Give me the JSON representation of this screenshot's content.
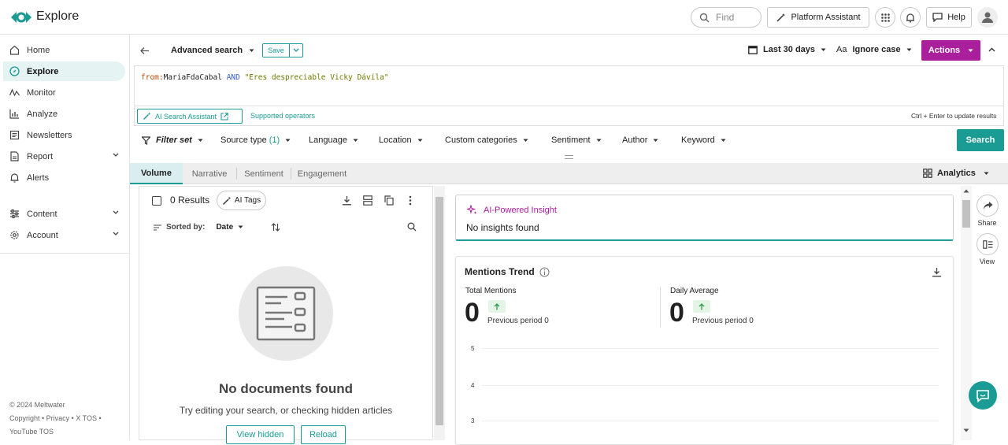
{
  "app": {
    "title": "Explore"
  },
  "topbar": {
    "find_placeholder": "Find",
    "platform_assistant_label": "Platform Assistant",
    "help_label": "Help"
  },
  "sidebar": {
    "items": [
      {
        "label": "Home",
        "icon": "home-icon"
      },
      {
        "label": "Explore",
        "icon": "compass-icon",
        "active": true
      },
      {
        "label": "Monitor",
        "icon": "pulse-icon"
      },
      {
        "label": "Analyze",
        "icon": "bar-chart-icon"
      },
      {
        "label": "Newsletters",
        "icon": "newsletter-icon"
      },
      {
        "label": "Report",
        "icon": "report-icon",
        "expandable": true
      },
      {
        "label": "Alerts",
        "icon": "bell-icon"
      },
      {
        "label": "Content",
        "icon": "sliders-icon",
        "expandable": true
      },
      {
        "label": "Account",
        "icon": "gear-icon",
        "expandable": true
      }
    ],
    "footer": {
      "copyright": "© 2024 Meltwater",
      "links_line1": "Copyright • Privacy • X TOS •",
      "links_line2": "YouTube TOS"
    }
  },
  "search": {
    "mode_label": "Advanced search",
    "save_label": "Save",
    "date_range": "Last 30 days",
    "case_label": "Ignore case",
    "actions_label": "Actions",
    "query": {
      "op1": "from:",
      "val1": "MariaFdaCabal",
      "kw": " AND ",
      "str": "\"Eres despreciable Vicky Dávila\""
    },
    "ai_assistant_label": "AI Search Assistant",
    "supported_operators_label": "Supported operators",
    "hint": "Ctrl + Enter to update results",
    "filters": {
      "filter_set": "Filter set",
      "source_type": "Source type",
      "source_type_count": "(1)",
      "language": "Language",
      "location": "Location",
      "custom_categories": "Custom categories",
      "sentiment": "Sentiment",
      "author": "Author",
      "keyword": "Keyword"
    },
    "search_button": "Search"
  },
  "tabs": [
    {
      "label": "Volume",
      "active": true
    },
    {
      "label": "Narrative"
    },
    {
      "label": "Sentiment"
    },
    {
      "label": "Engagement"
    }
  ],
  "analytics_label": "Analytics",
  "results": {
    "count_label": "0 Results",
    "ai_tags_label": "AI Tags",
    "sorted_by_label": "Sorted by:",
    "sort_value": "Date",
    "empty_title": "No documents found",
    "empty_sub": "Try editing your search, or checking hidden articles",
    "view_hidden_label": "View hidden",
    "reload_label": "Reload"
  },
  "insight": {
    "title": "AI-Powered Insight",
    "body": "No insights found"
  },
  "mentions": {
    "title": "Mentions Trend",
    "total_label": "Total Mentions",
    "total_value": "0",
    "total_prev": "Previous period 0",
    "daily_label": "Daily Average",
    "daily_value": "0",
    "daily_prev": "Previous period 0",
    "y_ticks": [
      "5",
      "4",
      "3"
    ]
  },
  "rail": {
    "share_label": "Share",
    "view_label": "View"
  },
  "colors": {
    "accent": "#1a9b94",
    "actions": "#a91f9c"
  }
}
